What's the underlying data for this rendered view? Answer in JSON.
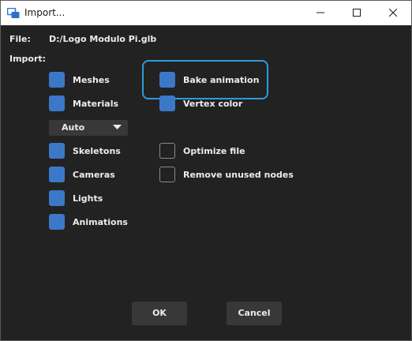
{
  "window": {
    "title": "Import..."
  },
  "file": {
    "label": "File:",
    "value": "D:/Logo Modulo Pi.glb"
  },
  "import_label": "Import:",
  "options": {
    "meshes": {
      "label": "Meshes",
      "checked": true
    },
    "materials": {
      "label": "Materials",
      "checked": true
    },
    "skeletons": {
      "label": "Skeletons",
      "checked": true
    },
    "cameras": {
      "label": "Cameras",
      "checked": true
    },
    "lights": {
      "label": "Lights",
      "checked": true
    },
    "animations": {
      "label": "Animations",
      "checked": true
    },
    "bake_animation": {
      "label": "Bake animation",
      "checked": true
    },
    "vertex_color": {
      "label": "Vertex color",
      "checked": true
    },
    "optimize_file": {
      "label": "Optimize file",
      "checked": false
    },
    "remove_unused_nodes": {
      "label": "Remove unused nodes",
      "checked": false
    }
  },
  "material_mode": {
    "selected": "Auto"
  },
  "buttons": {
    "ok": "OK",
    "cancel": "Cancel"
  },
  "colors": {
    "accent_checked": "#3c78c8",
    "highlight_outline": "#2e9be0",
    "background": "#222222",
    "button": "#383838"
  }
}
